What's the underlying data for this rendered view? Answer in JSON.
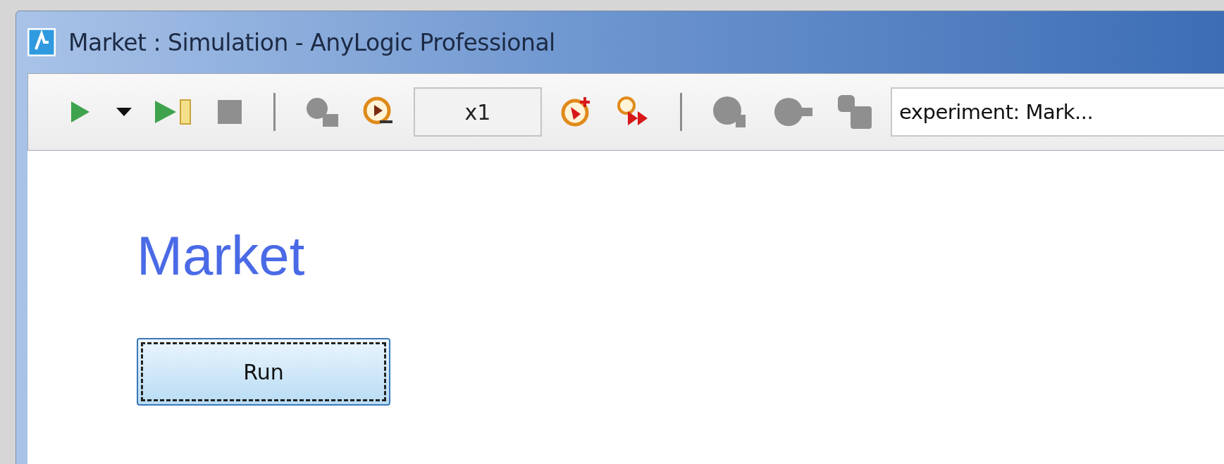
{
  "window": {
    "title": "Market : Simulation - AnyLogic Professional"
  },
  "toolbar": {
    "run_buttons": [
      {
        "disabled": false
      },
      {
        "disabled": false
      },
      {
        "disabled": false
      },
      {
        "disabled": true
      }
    ],
    "speed_buttons_before": [
      {
        "disabled": true
      },
      {
        "disabled": false
      }
    ],
    "speed": "x1",
    "speed_buttons_after": [
      {
        "disabled": false
      },
      {
        "disabled": false
      }
    ],
    "view_buttons": [
      {
        "disabled": true
      },
      {
        "disabled": true
      },
      {
        "disabled": true
      }
    ],
    "experiment": "experiment: Mark..."
  },
  "content": {
    "title": "Market",
    "run_button": {
      "label": "Run",
      "focused": true
    }
  }
}
